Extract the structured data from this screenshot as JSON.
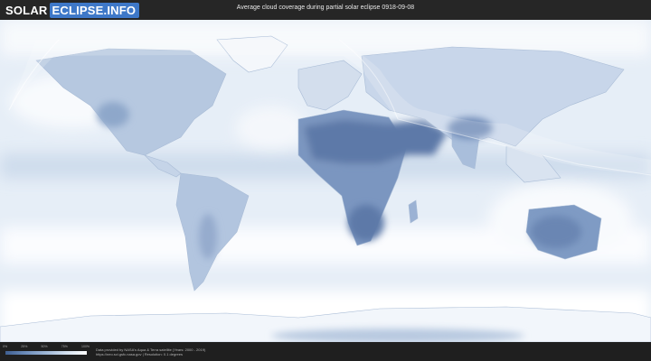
{
  "header": {
    "logo_solar": "SOLAR",
    "logo_rest": "ECLIPSE.INFO",
    "title": "Average cloud coverage during partial solar eclipse 0918-09-08"
  },
  "map": {
    "layer": "cloud-coverage",
    "ocean_color": "#e6eef7",
    "cloud_light_color": "#ffffff",
    "cloud_dark_color": "#4a6a9a",
    "eclipse_overlay_color": "#ffffff"
  },
  "legend": {
    "ticks": [
      "0%",
      "25%",
      "50%",
      "75%",
      "100%"
    ],
    "gradient_colors": [
      "#3f5f91",
      "#6d8dbb",
      "#9db6d6",
      "#d4e1ef",
      "#ffffff"
    ]
  },
  "footer": {
    "credit_line1": "Data provided by NASA's Aqua & Terra satellite (Years: 2000 - 2019)",
    "credit_line2": "https://neo.sci.gsfc.nasa.gov | Resolution: 0.1 degrees"
  }
}
